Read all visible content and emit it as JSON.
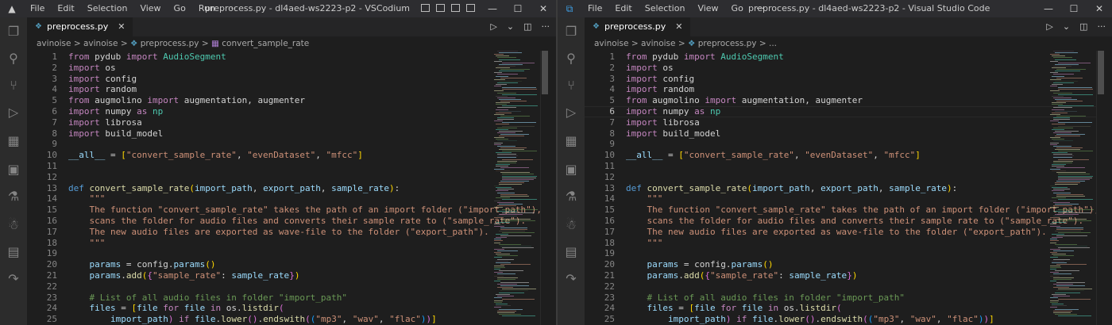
{
  "left": {
    "window_title": "preprocess.py - dl4aed-ws2223-p2 - VSCodium",
    "menu": [
      "File",
      "Edit",
      "Selection",
      "View",
      "Go",
      "Run",
      "···"
    ],
    "tab_label": "preprocess.py",
    "breadcrumbs": [
      "avinoise",
      "avinoise",
      "preprocess.py",
      "convert_sample_rate"
    ],
    "active_line": null
  },
  "right": {
    "window_title": "preprocess.py - dl4aed-ws2223-p2 - Visual Studio Code",
    "menu": [
      "File",
      "Edit",
      "Selection",
      "View",
      "Go",
      "···"
    ],
    "tab_label": "preprocess.py",
    "breadcrumbs": [
      "avinoise",
      "avinoise",
      "preprocess.py",
      "..."
    ],
    "active_line": 6
  },
  "window_controls": [
    "—",
    "☐",
    "✕"
  ],
  "tab_close": "✕",
  "tab_actions": [
    "▷",
    "⌄",
    "◫",
    "···"
  ],
  "activity_icons": [
    "files-icon",
    "search-icon",
    "source-control-icon",
    "run-debug-icon",
    "extensions-icon",
    "remote-explorer-icon",
    "testing-icon",
    "alien-icon",
    "notebook-icon",
    "share-icon"
  ],
  "code": {
    "lines": [
      {
        "n": 1,
        "t": [
          [
            "kw",
            "from"
          ],
          [
            "",
            " pydub "
          ],
          [
            "kw",
            "import"
          ],
          [
            "cls",
            " AudioSegment"
          ]
        ]
      },
      {
        "n": 2,
        "t": [
          [
            "kw",
            "import"
          ],
          [
            "",
            " os"
          ]
        ]
      },
      {
        "n": 3,
        "t": [
          [
            "kw",
            "import"
          ],
          [
            "",
            " config"
          ]
        ]
      },
      {
        "n": 4,
        "t": [
          [
            "kw",
            "import"
          ],
          [
            "",
            " random"
          ]
        ]
      },
      {
        "n": 5,
        "t": [
          [
            "kw",
            "from"
          ],
          [
            "",
            " augmolino "
          ],
          [
            "kw",
            "import"
          ],
          [
            "",
            " augmentation, augmenter"
          ]
        ]
      },
      {
        "n": 6,
        "t": [
          [
            "kw",
            "import"
          ],
          [
            "",
            " numpy "
          ],
          [
            "kw",
            "as"
          ],
          [
            "cls",
            " np"
          ]
        ]
      },
      {
        "n": 7,
        "t": [
          [
            "kw",
            "import"
          ],
          [
            "",
            " librosa"
          ]
        ]
      },
      {
        "n": 8,
        "t": [
          [
            "kw",
            "import"
          ],
          [
            "",
            " build_model"
          ]
        ]
      },
      {
        "n": 9,
        "t": []
      },
      {
        "n": 10,
        "t": [
          [
            "var",
            "__all__"
          ],
          [
            "",
            " = "
          ],
          [
            "br1",
            "["
          ],
          [
            "str",
            "\"convert_sample_rate\""
          ],
          [
            "",
            ", "
          ],
          [
            "str",
            "\"evenDataset\""
          ],
          [
            "",
            ", "
          ],
          [
            "str",
            "\"mfcc\""
          ],
          [
            "br1",
            "]"
          ]
        ]
      },
      {
        "n": 11,
        "t": []
      },
      {
        "n": 12,
        "t": []
      },
      {
        "n": 13,
        "t": [
          [
            "def",
            "def"
          ],
          [
            "fn",
            " convert_sample_rate"
          ],
          [
            "br1",
            "("
          ],
          [
            "var",
            "import_path"
          ],
          [
            "",
            ", "
          ],
          [
            "var",
            "export_path"
          ],
          [
            "",
            ", "
          ],
          [
            "var",
            "sample_rate"
          ],
          [
            "br1",
            ")"
          ],
          [
            "",
            ":"
          ]
        ]
      },
      {
        "n": 14,
        "t": [
          [
            "str",
            "    \"\"\""
          ]
        ]
      },
      {
        "n": 15,
        "t": [
          [
            "str",
            "    The function \"convert_sample_rate\" takes the path of an import folder (\"import_path\"),"
          ]
        ]
      },
      {
        "n": 16,
        "t": [
          [
            "str",
            "    scans the folder for audio files and converts their sample rate to (\"sample_rate\")."
          ]
        ]
      },
      {
        "n": 17,
        "t": [
          [
            "str",
            "    The new audio files are exported as wave-file to the folder (\"export_path\")."
          ]
        ]
      },
      {
        "n": 18,
        "t": [
          [
            "str",
            "    \"\"\""
          ]
        ]
      },
      {
        "n": 19,
        "t": []
      },
      {
        "n": 20,
        "t": [
          [
            "var",
            "    params"
          ],
          [
            "",
            " = config."
          ],
          [
            "var",
            "params"
          ],
          [
            "br1",
            "()"
          ]
        ]
      },
      {
        "n": 21,
        "t": [
          [
            "var",
            "    params"
          ],
          [
            "",
            "."
          ],
          [
            "fn",
            "add"
          ],
          [
            "br1",
            "("
          ],
          [
            "br2",
            "{"
          ],
          [
            "str",
            "\"sample_rate\""
          ],
          [
            "",
            ": "
          ],
          [
            "var",
            "sample_rate"
          ],
          [
            "br2",
            "}"
          ],
          [
            "br1",
            ")"
          ]
        ]
      },
      {
        "n": 22,
        "t": []
      },
      {
        "n": 23,
        "t": [
          [
            "cmt",
            "    # List of all audio files in folder \"import_path\""
          ]
        ]
      },
      {
        "n": 24,
        "t": [
          [
            "var",
            "    files"
          ],
          [
            "",
            " = "
          ],
          [
            "br1",
            "["
          ],
          [
            "var",
            "file"
          ],
          [
            "kw",
            " for"
          ],
          [
            "var",
            " file"
          ],
          [
            "kw",
            " in"
          ],
          [
            "",
            " os."
          ],
          [
            "fn",
            "listdir"
          ],
          [
            "br2",
            "("
          ]
        ]
      },
      {
        "n": 25,
        "t": [
          [
            "var",
            "        import_path"
          ],
          [
            "br2",
            ")"
          ],
          [
            "kw",
            " if"
          ],
          [
            "var",
            " file"
          ],
          [
            "",
            "."
          ],
          [
            "fn",
            "lower"
          ],
          [
            "br2",
            "()"
          ],
          [
            "",
            "."
          ],
          [
            "fn",
            "endswith"
          ],
          [
            "br2",
            "("
          ],
          [
            "br3",
            "("
          ],
          [
            "str",
            "\"mp3\""
          ],
          [
            "",
            ", "
          ],
          [
            "str",
            "\"wav\""
          ],
          [
            "",
            ", "
          ],
          [
            "str",
            "\"flac\""
          ],
          [
            "br3",
            ")"
          ],
          [
            "br2",
            ")"
          ],
          [
            "br1",
            "]"
          ]
        ]
      }
    ]
  }
}
